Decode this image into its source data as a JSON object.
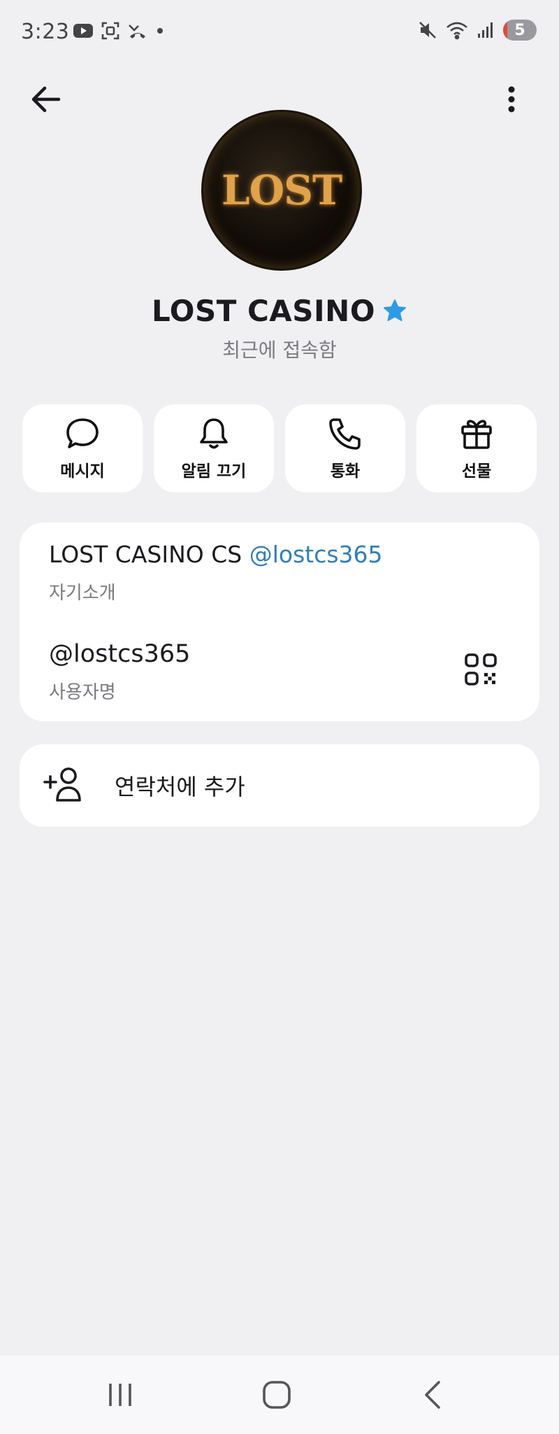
{
  "status_bar": {
    "time": "3:23",
    "battery_level": "5",
    "icons_left": [
      "youtube-icon",
      "screen-capture-icon",
      "missed-call-icon",
      "dot-icon"
    ],
    "icons_right": [
      "mute-icon",
      "wifi-icon",
      "signal-icon"
    ]
  },
  "header": {
    "back_icon": "arrow-left-icon",
    "more_icon": "more-vertical-icon"
  },
  "profile": {
    "avatar_logo_text": "LOST",
    "name": "LOST CASINO",
    "verified_icon": "star-badge-icon",
    "status": "최근에 접속함",
    "accent_color": "#2f9be6"
  },
  "actions": [
    {
      "label": "메시지",
      "icon": "chat-bubble-icon"
    },
    {
      "label": "알림 끄기",
      "icon": "bell-icon"
    },
    {
      "label": "통화",
      "icon": "phone-icon"
    },
    {
      "label": "선물",
      "icon": "gift-icon"
    }
  ],
  "info": {
    "bio_prefix": "LOST CASINO CS ",
    "bio_link": "@lostcs365",
    "bio_caption": "자기소개",
    "username": "@lostcs365",
    "username_caption": "사용자명",
    "link_color": "#2f7fb8",
    "qr_icon": "qr-code-icon"
  },
  "add_contact": {
    "label": "연락처에 추가",
    "icon": "add-person-icon"
  },
  "nav": {
    "recent_icon": "recent-apps-icon",
    "home_icon": "home-icon",
    "back_icon": "back-chevron-icon"
  }
}
